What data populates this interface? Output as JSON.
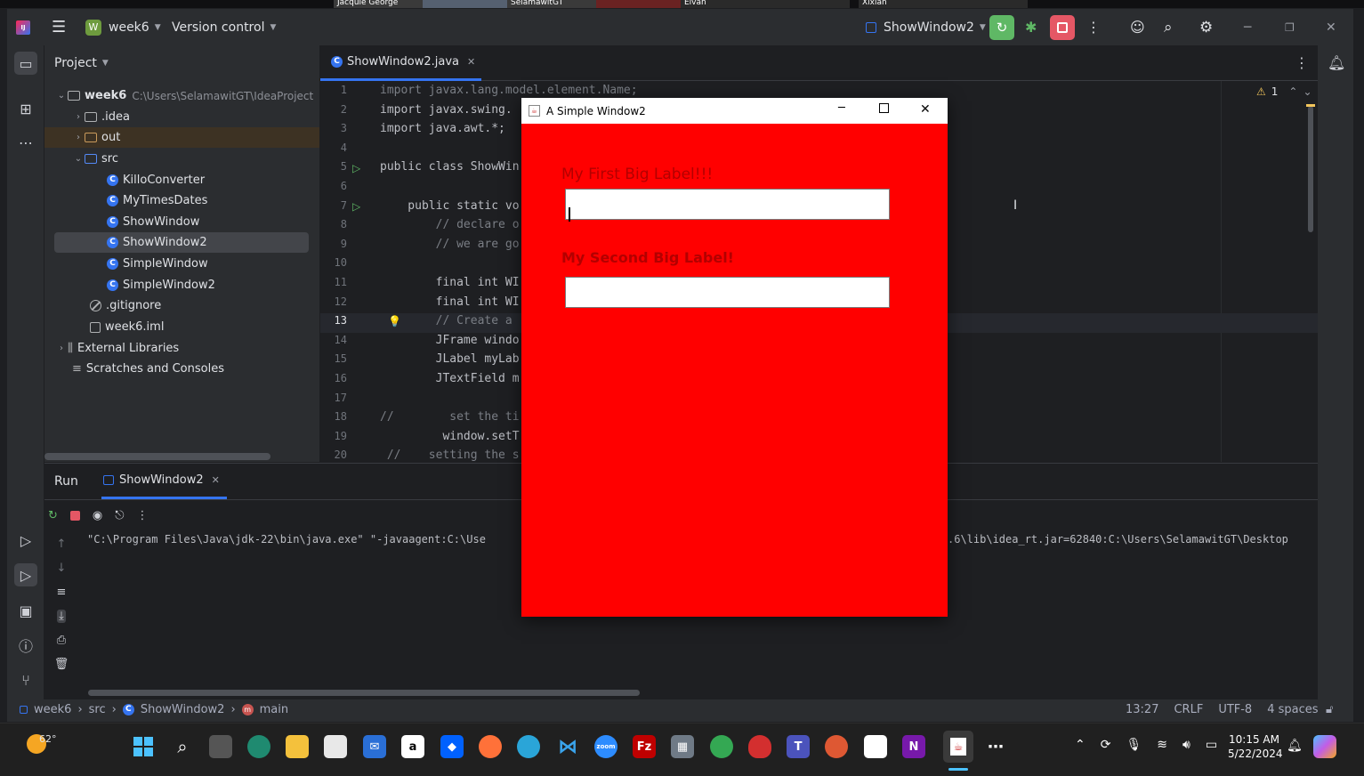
{
  "video_strip": {
    "names": [
      "Jacquie George",
      "SelamawitGT",
      "Elvan",
      "Xixian"
    ]
  },
  "titlebar": {
    "project_badge": "W",
    "project_name": "week6",
    "vcs_label": "Version control",
    "run_config": "ShowWindow2"
  },
  "project_panel": {
    "title": "Project",
    "tree": [
      {
        "label": "week6",
        "hint": "C:\\Users\\SelamawitGT\\IdeaProject",
        "type": "module"
      },
      {
        "label": ".idea",
        "type": "folder"
      },
      {
        "label": "out",
        "type": "folder"
      },
      {
        "label": "src",
        "type": "folder"
      },
      {
        "label": "KilloConverter",
        "type": "class"
      },
      {
        "label": "MyTimesDates",
        "type": "class"
      },
      {
        "label": "ShowWindow",
        "type": "class"
      },
      {
        "label": "ShowWindow2",
        "type": "class"
      },
      {
        "label": "SimpleWindow",
        "type": "class"
      },
      {
        "label": "SimpleWindow2",
        "type": "class"
      },
      {
        "label": ".gitignore",
        "type": "ignore"
      },
      {
        "label": "week6.iml",
        "type": "file"
      },
      {
        "label": "External Libraries",
        "type": "lib"
      },
      {
        "label": "Scratches and Consoles",
        "type": "scratch"
      }
    ]
  },
  "editor": {
    "tab_label": "ShowWindow2.java",
    "warning_count": "1",
    "lines": [
      {
        "n": "1",
        "text": "import javax.lang.model.element.Name;"
      },
      {
        "n": "2",
        "text": "import javax.swing."
      },
      {
        "n": "3",
        "text": "import java.awt.*;"
      },
      {
        "n": "4",
        "text": ""
      },
      {
        "n": "5",
        "text": "public class ShowWin"
      },
      {
        "n": "6",
        "text": ""
      },
      {
        "n": "7",
        "text": "    public static vo"
      },
      {
        "n": "8",
        "text": "        // declare o"
      },
      {
        "n": "9",
        "text": "        // we are go"
      },
      {
        "n": "10",
        "text": ""
      },
      {
        "n": "11",
        "text": "        final int WI"
      },
      {
        "n": "12",
        "text": "        final int WI"
      },
      {
        "n": "13",
        "text": "        // Create a "
      },
      {
        "n": "14",
        "text": "        JFrame windo"
      },
      {
        "n": "15",
        "text": "        JLabel myLab"
      },
      {
        "n": "16",
        "text": "        JTextField m"
      },
      {
        "n": "17",
        "text": ""
      },
      {
        "n": "18",
        "text": "//        set the ti"
      },
      {
        "n": "19",
        "text": "         window.setT"
      },
      {
        "n": "20",
        "text": " //    setting the s"
      }
    ]
  },
  "run_panel": {
    "title": "Run",
    "tab_label": "ShowWindow2",
    "console_left": "\"C:\\Program Files\\Java\\jdk-22\\bin\\java.exe\" \"-javaagent:C:\\Use",
    "console_right": ".6\\lib\\idea_rt.jar=62840:C:\\Users\\SelamawitGT\\Desktop"
  },
  "statusbar": {
    "crumb_project": "week6",
    "crumb_src": "src",
    "crumb_class": "ShowWindow2",
    "crumb_method": "main",
    "position": "13:27",
    "line_sep": "CRLF",
    "encoding": "UTF-8",
    "indent": "4 spaces"
  },
  "swing_window": {
    "title": "A Simple Window2",
    "label1": "My First Big Label!!!",
    "field1_value": "",
    "label2": "My Second Big Label!",
    "field2_value": "",
    "background": "#ff0000"
  },
  "taskbar": {
    "weather": "62°",
    "time": "10:15 AM",
    "date": "5/22/2024"
  },
  "colors": {
    "accent": "#3574f0",
    "run_green": "#5fb865",
    "stop_red": "#e55765"
  }
}
